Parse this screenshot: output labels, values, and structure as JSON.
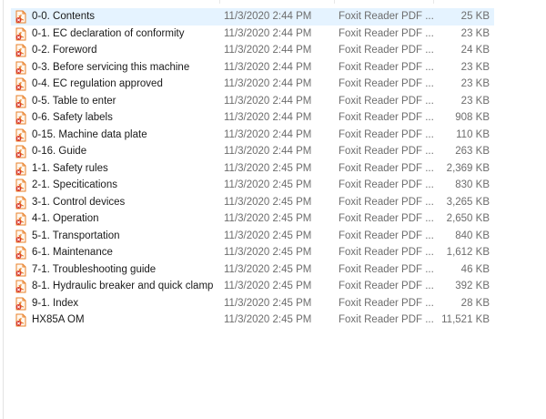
{
  "files": [
    {
      "name": "0-0. Contents",
      "date": "11/3/2020 2:44 PM",
      "type": "Foxit Reader PDF ...",
      "size": "25 KB",
      "selected": true
    },
    {
      "name": "0-1. EC declaration of conformity",
      "date": "11/3/2020 2:44 PM",
      "type": "Foxit Reader PDF ...",
      "size": "23 KB"
    },
    {
      "name": "0-2. Foreword",
      "date": "11/3/2020 2:44 PM",
      "type": "Foxit Reader PDF ...",
      "size": "24 KB"
    },
    {
      "name": "0-3. Before servicing this machine",
      "date": "11/3/2020 2:44 PM",
      "type": "Foxit Reader PDF ...",
      "size": "23 KB"
    },
    {
      "name": "0-4. EC regulation approved",
      "date": "11/3/2020 2:44 PM",
      "type": "Foxit Reader PDF ...",
      "size": "23 KB"
    },
    {
      "name": "0-5. Table to enter",
      "date": "11/3/2020 2:44 PM",
      "type": "Foxit Reader PDF ...",
      "size": "23 KB"
    },
    {
      "name": "0-6. Safety labels",
      "date": "11/3/2020 2:44 PM",
      "type": "Foxit Reader PDF ...",
      "size": "908 KB"
    },
    {
      "name": "0-15. Machine data plate",
      "date": "11/3/2020 2:44 PM",
      "type": "Foxit Reader PDF ...",
      "size": "110 KB"
    },
    {
      "name": "0-16. Guide",
      "date": "11/3/2020 2:44 PM",
      "type": "Foxit Reader PDF ...",
      "size": "263 KB"
    },
    {
      "name": "1-1. Safety rules",
      "date": "11/3/2020 2:45 PM",
      "type": "Foxit Reader PDF ...",
      "size": "2,369 KB"
    },
    {
      "name": "2-1. Specitications",
      "date": "11/3/2020 2:45 PM",
      "type": "Foxit Reader PDF ...",
      "size": "830 KB"
    },
    {
      "name": "3-1. Control devices",
      "date": "11/3/2020 2:45 PM",
      "type": "Foxit Reader PDF ...",
      "size": "3,265 KB"
    },
    {
      "name": "4-1. Operation",
      "date": "11/3/2020 2:45 PM",
      "type": "Foxit Reader PDF ...",
      "size": "2,650 KB"
    },
    {
      "name": "5-1. Transportation",
      "date": "11/3/2020 2:45 PM",
      "type": "Foxit Reader PDF ...",
      "size": "840 KB"
    },
    {
      "name": "6-1. Maintenance",
      "date": "11/3/2020 2:45 PM",
      "type": "Foxit Reader PDF ...",
      "size": "1,612 KB"
    },
    {
      "name": "7-1. Troubleshooting guide",
      "date": "11/3/2020 2:45 PM",
      "type": "Foxit Reader PDF ...",
      "size": "46 KB"
    },
    {
      "name": "8-1. Hydraulic breaker and quick clamp",
      "date": "11/3/2020 2:45 PM",
      "type": "Foxit Reader PDF ...",
      "size": "392 KB"
    },
    {
      "name": "9-1. Index",
      "date": "11/3/2020 2:45 PM",
      "type": "Foxit Reader PDF ...",
      "size": "28 KB"
    },
    {
      "name": "HX85A OM",
      "date": "11/3/2020 2:45 PM",
      "type": "Foxit Reader PDF ...",
      "size": "11,521 KB"
    }
  ],
  "file_icon": "foxit-pdf-icon",
  "colors": {
    "selection": "#e5f3ff",
    "icon_orange": "#e8812a",
    "icon_red": "#d83a2e"
  }
}
